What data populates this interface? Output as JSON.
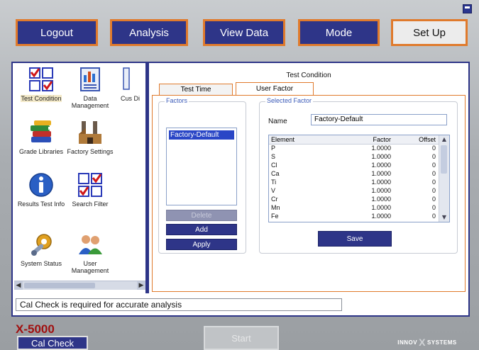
{
  "nav": {
    "logout": "Logout",
    "analysis": "Analysis",
    "view_data": "View Data",
    "mode": "Mode",
    "set_up": "Set Up"
  },
  "sidebar": {
    "items": [
      {
        "label": "Test Condition",
        "icon": "checkbox-grid-icon"
      },
      {
        "label": "Data Management",
        "icon": "chart-document-icon"
      },
      {
        "label": "Cus Di",
        "icon": "partial-icon"
      },
      {
        "label": "Grade Libraries",
        "icon": "books-icon"
      },
      {
        "label": "Factory Settings",
        "icon": "factory-icon"
      },
      {
        "label": "Results Test Info",
        "icon": "info-icon"
      },
      {
        "label": "Search Filter",
        "icon": "checkbox-grid-icon"
      },
      {
        "label": "System Status",
        "icon": "wrench-gear-icon"
      },
      {
        "label": "User Management",
        "icon": "users-icon"
      }
    ]
  },
  "test_condition": {
    "title": "Test Condition",
    "tabs": [
      "Test Time",
      "User Factor"
    ],
    "active_tab": "User Factor",
    "factors": {
      "legend": "Factors",
      "items": [
        "Factory-Default"
      ],
      "selected": "Factory-Default",
      "delete_label": "Delete",
      "add_label": "Add",
      "apply_label": "Apply"
    },
    "selected_factor": {
      "legend": "Selected Factor",
      "name_label": "Name",
      "name_value": "Factory-Default",
      "columns": [
        "Element",
        "Factor",
        "Offset"
      ],
      "rows": [
        [
          "P",
          "1.0000",
          "0"
        ],
        [
          "S",
          "1.0000",
          "0"
        ],
        [
          "Cl",
          "1.0000",
          "0"
        ],
        [
          "Ca",
          "1.0000",
          "0"
        ],
        [
          "Ti",
          "1.0000",
          "0"
        ],
        [
          "V",
          "1.0000",
          "0"
        ],
        [
          "Cr",
          "1.0000",
          "0"
        ],
        [
          "Mn",
          "1.0000",
          "0"
        ],
        [
          "Fe",
          "1.0000",
          "0"
        ]
      ],
      "save_label": "Save"
    }
  },
  "status": {
    "message": "Cal Check is required for accurate analysis"
  },
  "footer": {
    "model": "X-5000",
    "cal_check": "Cal Check",
    "start": "Start",
    "brand_left": "INNOV",
    "brand_x": "X",
    "brand_right": "SYSTEMS"
  },
  "colors": {
    "accent_orange": "#e07a2c",
    "button_blue": "#2e3588",
    "model_red": "#a01010"
  }
}
